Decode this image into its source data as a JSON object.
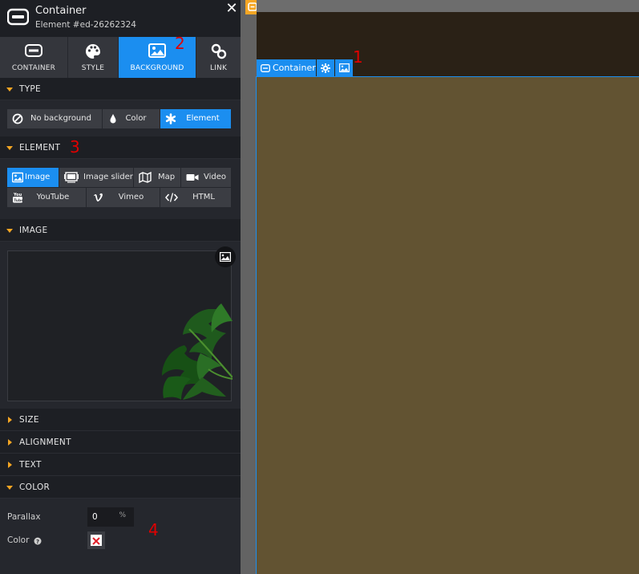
{
  "panel": {
    "title": "Container",
    "subtitle": "Element #ed-26262324",
    "close_label": "✕",
    "tabs": [
      {
        "label": "CONTAINER",
        "icon": "container-icon"
      },
      {
        "label": "STYLE",
        "icon": "palette-icon"
      },
      {
        "label": "BACKGROUND",
        "icon": "image-icon",
        "active": true
      },
      {
        "label": "LINK",
        "icon": "link-icon"
      }
    ],
    "sections": {
      "type": "TYPE",
      "element": "ELEMENT",
      "image": "IMAGE",
      "size": "SIZE",
      "alignment": "ALIGNMENT",
      "text": "TEXT",
      "color": "COLOR"
    },
    "type_options": [
      {
        "label": "No background",
        "icon": "no-background-icon"
      },
      {
        "label": "Color",
        "icon": "droplet-icon"
      },
      {
        "label": "Element",
        "icon": "asterisk-icon",
        "active": true
      }
    ],
    "element_options": [
      {
        "label": "Image",
        "icon": "image-icon",
        "active": true
      },
      {
        "label": "Image slider",
        "icon": "slider-icon"
      },
      {
        "label": "Map",
        "icon": "map-icon"
      },
      {
        "label": "Video",
        "icon": "video-icon"
      },
      {
        "label": "YouTube",
        "icon": "youtube-icon"
      },
      {
        "label": "Vimeo",
        "icon": "vimeo-icon"
      },
      {
        "label": "HTML",
        "icon": "code-icon"
      }
    ],
    "parallax": {
      "label": "Parallax",
      "value": "0",
      "unit": "%"
    },
    "color": {
      "label": "Color",
      "help_icon": "help-icon",
      "swatch": "none"
    }
  },
  "canvas": {
    "container_tag": "Container",
    "colors": {
      "accent": "#1b8ef0",
      "olive": "#625332",
      "dark": "#2a2116",
      "orange": "#f5a623"
    }
  },
  "annotations": [
    "1",
    "2",
    "3",
    "4"
  ]
}
